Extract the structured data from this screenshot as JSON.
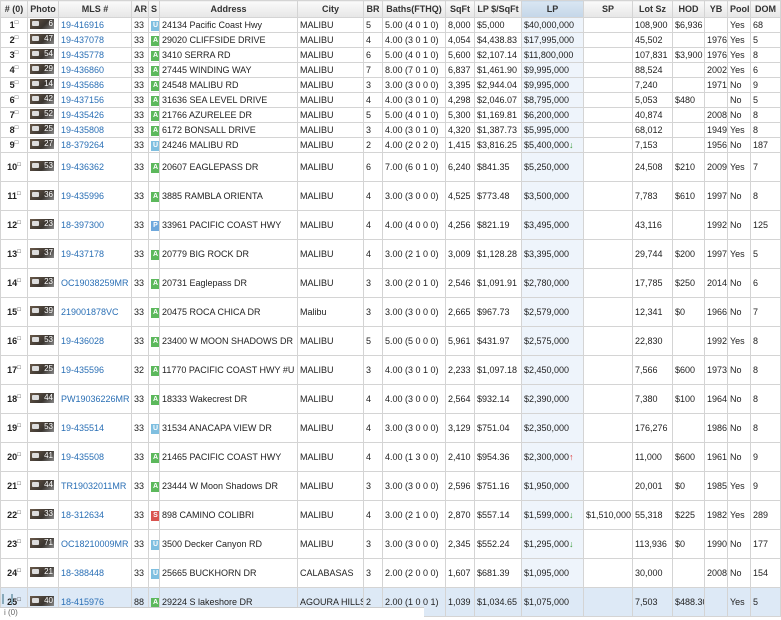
{
  "columns": [
    "# (0)",
    "Photo",
    "MLS #",
    "AR",
    "S",
    "Address",
    "City",
    "BR",
    "Baths(FTHQ)",
    "SqFt",
    "LP $/SqFt",
    "LP",
    "SP",
    "Lot Sz",
    "HOD",
    "YB",
    "Pool",
    "DOM"
  ],
  "rows": [
    {
      "n": "1",
      "photos": "6",
      "mls": "19-416916",
      "ar": "33",
      "st": "U",
      "addr": "24134 Pacific Coast Hwy",
      "city": "MALIBU",
      "br": "5",
      "baths": "5.00 (4 0 1 0)",
      "sqft": "8,000",
      "lpsqft": "$5,000",
      "lp": "$40,000,000",
      "arrow": "",
      "sp": "",
      "lot": "108,900",
      "hod": "$6,936",
      "yb": "",
      "pool": "Yes",
      "dom": "68"
    },
    {
      "n": "2",
      "photos": "47",
      "mls": "19-437078",
      "ar": "33",
      "st": "A",
      "addr": "29020 CLIFFSIDE DRIVE",
      "city": "MALIBU",
      "br": "4",
      "baths": "4.00 (3 0 1 0)",
      "sqft": "4,054",
      "lpsqft": "$4,438.83",
      "lp": "$17,995,000",
      "arrow": "",
      "sp": "",
      "lot": "45,502",
      "hod": "",
      "yb": "1976",
      "pool": "Yes",
      "dom": "5"
    },
    {
      "n": "3",
      "photos": "54",
      "mls": "19-435778",
      "ar": "33",
      "st": "A",
      "addr": "3410 SERRA RD",
      "city": "MALIBU",
      "br": "6",
      "baths": "5.00 (4 0 1 0)",
      "sqft": "5,600",
      "lpsqft": "$2,107.14",
      "lp": "$11,800,000",
      "arrow": "",
      "sp": "",
      "lot": "107,831",
      "hod": "$3,900",
      "yb": "1976",
      "pool": "Yes",
      "dom": "8"
    },
    {
      "n": "4",
      "photos": "29",
      "mls": "19-436860",
      "ar": "33",
      "st": "A",
      "addr": "27445 WINDING WAY",
      "city": "MALIBU",
      "br": "7",
      "baths": "8.00 (7 0 1 0)",
      "sqft": "6,837",
      "lpsqft": "$1,461.90",
      "lp": "$9,995,000",
      "arrow": "",
      "sp": "",
      "lot": "88,524",
      "hod": "",
      "yb": "2002",
      "pool": "Yes",
      "dom": "6"
    },
    {
      "n": "5",
      "photos": "14",
      "mls": "19-435686",
      "ar": "33",
      "st": "A",
      "addr": "24548 MALIBU RD",
      "city": "MALIBU",
      "br": "3",
      "baths": "3.00 (3 0 0 0)",
      "sqft": "3,395",
      "lpsqft": "$2,944.04",
      "lp": "$9,995,000",
      "arrow": "",
      "sp": "",
      "lot": "7,240",
      "hod": "",
      "yb": "1971",
      "pool": "No",
      "dom": "9"
    },
    {
      "n": "6",
      "photos": "42",
      "mls": "19-437156",
      "ar": "33",
      "st": "A",
      "addr": "31636 SEA LEVEL DRIVE",
      "city": "MALIBU",
      "br": "4",
      "baths": "4.00 (3 0 1 0)",
      "sqft": "4,298",
      "lpsqft": "$2,046.07",
      "lp": "$8,795,000",
      "arrow": "",
      "sp": "",
      "lot": "5,053",
      "hod": "$480",
      "yb": "",
      "pool": "No",
      "dom": "5"
    },
    {
      "n": "7",
      "photos": "52",
      "mls": "19-435426",
      "ar": "33",
      "st": "A",
      "addr": "21766 AZURELEE DR",
      "city": "MALIBU",
      "br": "5",
      "baths": "5.00 (4 0 1 0)",
      "sqft": "5,300",
      "lpsqft": "$1,169.81",
      "lp": "$6,200,000",
      "arrow": "",
      "sp": "",
      "lot": "40,874",
      "hod": "",
      "yb": "2008",
      "pool": "No",
      "dom": "8"
    },
    {
      "n": "8",
      "photos": "25",
      "mls": "19-435808",
      "ar": "33",
      "st": "A",
      "addr": "6172 BONSALL DRIVE",
      "city": "MALIBU",
      "br": "3",
      "baths": "4.00 (3 0 1 0)",
      "sqft": "4,320",
      "lpsqft": "$1,387.73",
      "lp": "$5,995,000",
      "arrow": "",
      "sp": "",
      "lot": "68,012",
      "hod": "",
      "yb": "1949",
      "pool": "Yes",
      "dom": "8"
    },
    {
      "n": "9",
      "photos": "27",
      "mls": "18-379264",
      "ar": "33",
      "st": "U",
      "addr": "24246 MALIBU RD",
      "city": "MALIBU",
      "br": "2",
      "baths": "4.00 (2 0 2 0)",
      "sqft": "1,415",
      "lpsqft": "$3,816.25",
      "lp": "$5,400,000",
      "arrow": "down",
      "sp": "",
      "lot": "7,153",
      "hod": "",
      "yb": "1956",
      "pool": "No",
      "dom": "187"
    },
    {
      "n": "10",
      "photos": "53",
      "mls": "19-436362",
      "ar": "33",
      "st": "A",
      "addr": "20607 EAGLEPASS DR",
      "city": "MALIBU",
      "br": "6",
      "baths": "7.00 (6 0 1 0)",
      "sqft": "6,240",
      "lpsqft": "$841.35",
      "lp": "$5,250,000",
      "arrow": "",
      "sp": "",
      "lot": "24,508",
      "hod": "$210",
      "yb": "2009",
      "pool": "Yes",
      "dom": "7"
    },
    {
      "n": "11",
      "photos": "36",
      "mls": "19-435996",
      "ar": "33",
      "st": "A",
      "addr": "3885 RAMBLA ORIENTA",
      "city": "MALIBU",
      "br": "4",
      "baths": "3.00 (3 0 0 0)",
      "sqft": "4,525",
      "lpsqft": "$773.48",
      "lp": "$3,500,000",
      "arrow": "",
      "sp": "",
      "lot": "7,783",
      "hod": "$610",
      "yb": "1997",
      "pool": "No",
      "dom": "8"
    },
    {
      "n": "12",
      "photos": "23",
      "mls": "18-397300",
      "ar": "33",
      "st": "P",
      "addr": "33961 PACIFIC COAST HWY",
      "city": "MALIBU",
      "br": "4",
      "baths": "4.00 (4 0 0 0)",
      "sqft": "4,256",
      "lpsqft": "$821.19",
      "lp": "$3,495,000",
      "arrow": "",
      "sp": "",
      "lot": "43,116",
      "hod": "",
      "yb": "1992",
      "pool": "No",
      "dom": "125"
    },
    {
      "n": "13",
      "photos": "37",
      "mls": "19-437178",
      "ar": "33",
      "st": "A",
      "addr": "20779 BIG ROCK DR",
      "city": "MALIBU",
      "br": "4",
      "baths": "3.00 (2 1 0 0)",
      "sqft": "3,009",
      "lpsqft": "$1,128.28",
      "lp": "$3,395,000",
      "arrow": "",
      "sp": "",
      "lot": "29,744",
      "hod": "$200",
      "yb": "1997",
      "pool": "Yes",
      "dom": "5"
    },
    {
      "n": "14",
      "photos": "23",
      "mls": "OC19038259MR",
      "ar": "33",
      "st": "A",
      "addr": "20731 Eaglepass DR",
      "city": "MALIBU",
      "br": "3",
      "baths": "3.00 (2 0 1 0)",
      "sqft": "2,546",
      "lpsqft": "$1,091.91",
      "lp": "$2,780,000",
      "arrow": "",
      "sp": "",
      "lot": "17,785",
      "hod": "$250",
      "yb": "2014",
      "pool": "No",
      "dom": "6"
    },
    {
      "n": "15",
      "photos": "39",
      "mls": "219001878VC",
      "ar": "33",
      "st": "A",
      "addr": "20475 ROCA CHICA DR",
      "city": "Malibu",
      "br": "3",
      "baths": "3.00 (3 0 0 0)",
      "sqft": "2,665",
      "lpsqft": "$967.73",
      "lp": "$2,579,000",
      "arrow": "",
      "sp": "",
      "lot": "12,341",
      "hod": "$0",
      "yb": "1966",
      "pool": "No",
      "dom": "7"
    },
    {
      "n": "16",
      "photos": "53",
      "mls": "19-436028",
      "ar": "33",
      "st": "A",
      "addr": "23400 W MOON SHADOWS DR",
      "city": "MALIBU",
      "br": "5",
      "baths": "5.00 (5 0 0 0)",
      "sqft": "5,961",
      "lpsqft": "$431.97",
      "lp": "$2,575,000",
      "arrow": "",
      "sp": "",
      "lot": "22,830",
      "hod": "",
      "yb": "1992",
      "pool": "Yes",
      "dom": "8"
    },
    {
      "n": "17",
      "photos": "25",
      "mls": "19-435596",
      "ar": "32",
      "st": "A",
      "addr": "11770 PACIFIC COAST HWY #U",
      "city": "MALIBU",
      "br": "3",
      "baths": "4.00 (3 0 1 0)",
      "sqft": "2,233",
      "lpsqft": "$1,097.18",
      "lp": "$2,450,000",
      "arrow": "",
      "sp": "",
      "lot": "7,566",
      "hod": "$600",
      "yb": "1973",
      "pool": "No",
      "dom": "8"
    },
    {
      "n": "18",
      "photos": "44",
      "mls": "PW19036226MR",
      "ar": "33",
      "st": "A",
      "addr": "18333 Wakecrest DR",
      "city": "MALIBU",
      "br": "4",
      "baths": "4.00 (3 0 0 0)",
      "sqft": "2,564",
      "lpsqft": "$932.14",
      "lp": "$2,390,000",
      "arrow": "",
      "sp": "",
      "lot": "7,380",
      "hod": "$100",
      "yb": "1964",
      "pool": "No",
      "dom": "8"
    },
    {
      "n": "19",
      "photos": "53",
      "mls": "19-435514",
      "ar": "33",
      "st": "U",
      "addr": "31534 ANACAPA VIEW DR",
      "city": "MALIBU",
      "br": "4",
      "baths": "3.00 (3 0 0 0)",
      "sqft": "3,129",
      "lpsqft": "$751.04",
      "lp": "$2,350,000",
      "arrow": "",
      "sp": "",
      "lot": "176,276",
      "hod": "",
      "yb": "1986",
      "pool": "No",
      "dom": "8"
    },
    {
      "n": "20",
      "photos": "41",
      "mls": "19-435508",
      "ar": "33",
      "st": "A",
      "addr": "21465 PACIFIC COAST HWY",
      "city": "MALIBU",
      "br": "4",
      "baths": "4.00 (1 3 0 0)",
      "sqft": "2,410",
      "lpsqft": "$954.36",
      "lp": "$2,300,000",
      "arrow": "up",
      "sp": "",
      "lot": "11,000",
      "hod": "$600",
      "yb": "1961",
      "pool": "No",
      "dom": "9"
    },
    {
      "n": "21",
      "photos": "44",
      "mls": "TR19032011MR",
      "ar": "33",
      "st": "A",
      "addr": "23444 W Moon Shadows DR",
      "city": "MALIBU",
      "br": "3",
      "baths": "3.00 (3 0 0 0)",
      "sqft": "2,596",
      "lpsqft": "$751.16",
      "lp": "$1,950,000",
      "arrow": "",
      "sp": "",
      "lot": "20,001",
      "hod": "$0",
      "yb": "1985",
      "pool": "Yes",
      "dom": "9"
    },
    {
      "n": "22",
      "photos": "33",
      "mls": "18-312634",
      "ar": "33",
      "st": "S",
      "addr": "898 CAMINO COLIBRI",
      "city": "MALIBU",
      "br": "4",
      "baths": "3.00 (2 1 0 0)",
      "sqft": "2,870",
      "lpsqft": "$557.14",
      "lp": "$1,599,000",
      "arrow": "down",
      "sp": "$1,510,000",
      "lot": "55,318",
      "hod": "$225",
      "yb": "1982",
      "pool": "Yes",
      "dom": "289"
    },
    {
      "n": "23",
      "photos": "71",
      "mls": "OC18210009MR",
      "ar": "33",
      "st": "U",
      "addr": "3500 Decker Canyon RD",
      "city": "MALIBU",
      "br": "3",
      "baths": "3.00 (3 0 0 0)",
      "sqft": "2,345",
      "lpsqft": "$552.24",
      "lp": "$1,295,000",
      "arrow": "down",
      "sp": "",
      "lot": "113,936",
      "hod": "$0",
      "yb": "1990",
      "pool": "No",
      "dom": "177"
    },
    {
      "n": "24",
      "photos": "21",
      "mls": "18-388448",
      "ar": "33",
      "st": "U",
      "addr": "25665 BUCKHORN DR",
      "city": "CALABASAS",
      "br": "3",
      "baths": "2.00 (2 0 0 0)",
      "sqft": "1,607",
      "lpsqft": "$681.39",
      "lp": "$1,095,000",
      "arrow": "",
      "sp": "",
      "lot": "30,000",
      "hod": "",
      "yb": "2008",
      "pool": "No",
      "dom": "154"
    },
    {
      "n": "25",
      "photos": "40",
      "mls": "18-415976",
      "ar": "88",
      "st": "A",
      "addr": "29224 S lakeshore DR",
      "city": "AGOURA HILLS",
      "br": "2",
      "baths": "2.00 (1 0 0 1)",
      "sqft": "1,039",
      "lpsqft": "$1,034.65",
      "lp": "$1,075,000",
      "arrow": "",
      "sp": "",
      "lot": "7,503",
      "hod": "$488.30",
      "yb": "",
      "pool": "Yes",
      "dom": "5"
    }
  ],
  "footer_text": "i (0)"
}
